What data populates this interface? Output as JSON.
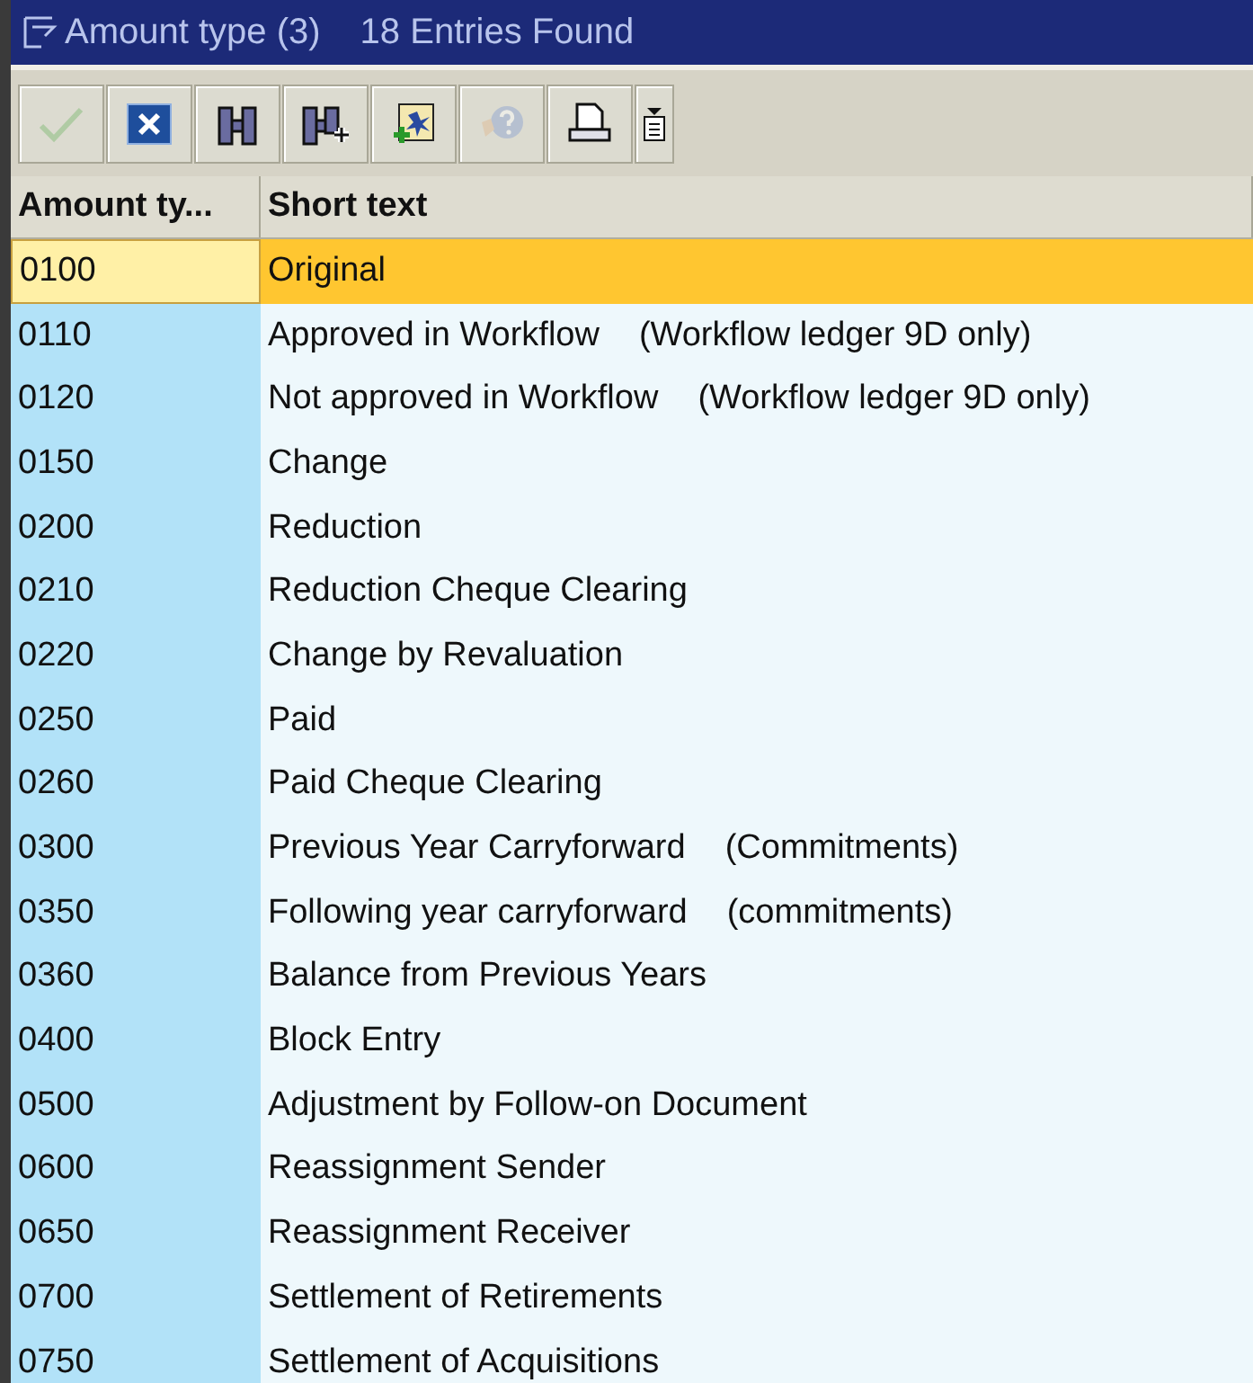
{
  "window": {
    "title": "Amount type (3)",
    "count": "18 Entries Found"
  },
  "toolbar": [
    {
      "kind": "check",
      "disabled": true
    },
    {
      "kind": "cancel",
      "disabled": false
    },
    {
      "kind": "find",
      "disabled": false
    },
    {
      "kind": "find-next",
      "disabled": false
    },
    {
      "kind": "new",
      "disabled": false
    },
    {
      "kind": "help",
      "disabled": true
    },
    {
      "kind": "print",
      "disabled": false
    },
    {
      "kind": "menu",
      "disabled": false
    }
  ],
  "table": {
    "columns": [
      "Amount ty...",
      "Short text"
    ],
    "rows": [
      {
        "code": "0100",
        "text": "Original",
        "selected": true
      },
      {
        "code": "0110",
        "text": "Approved in Workflow",
        "note": "(Workflow ledger 9D only)",
        "selected": false
      },
      {
        "code": "0120",
        "text": "Not approved in Workflow",
        "note": "(Workflow ledger 9D only)",
        "selected": false
      },
      {
        "code": "0150",
        "text": "Change",
        "selected": false
      },
      {
        "code": "0200",
        "text": "Reduction",
        "selected": false
      },
      {
        "code": "0210",
        "text": "Reduction Cheque Clearing",
        "selected": false
      },
      {
        "code": "0220",
        "text": "Change by Revaluation",
        "selected": false
      },
      {
        "code": "0250",
        "text": "Paid",
        "selected": false
      },
      {
        "code": "0260",
        "text": "Paid Cheque Clearing",
        "selected": false
      },
      {
        "code": "0300",
        "text": "Previous Year Carryforward",
        "note": "(Commitments)",
        "selected": false
      },
      {
        "code": "0350",
        "text": "Following year carryforward",
        "note": "(commitments)",
        "selected": false
      },
      {
        "code": "0360",
        "text": "Balance from Previous Years",
        "selected": false
      },
      {
        "code": "0400",
        "text": "Block Entry",
        "selected": false
      },
      {
        "code": "0500",
        "text": "Adjustment by Follow-on Document",
        "selected": false
      },
      {
        "code": "0600",
        "text": "Reassignment Sender",
        "selected": false
      },
      {
        "code": "0650",
        "text": "Reassignment Receiver",
        "selected": false
      },
      {
        "code": "0700",
        "text": "Settlement of Retirements",
        "selected": false
      },
      {
        "code": "0750",
        "text": "Settlement of Acquisitions",
        "selected": false
      }
    ]
  }
}
